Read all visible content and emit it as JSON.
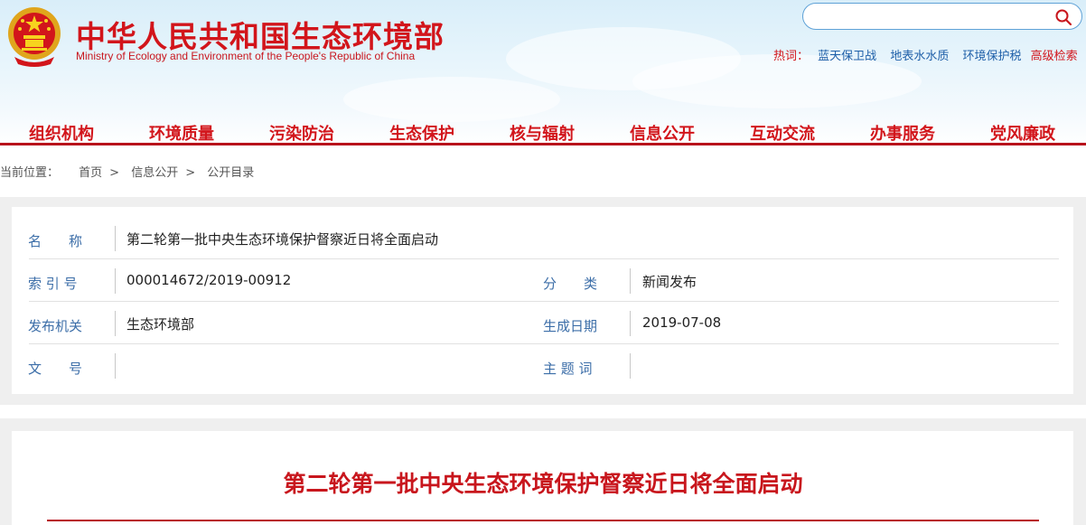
{
  "header": {
    "site_name_cn": "中华人民共和国生态环境部",
    "site_name_en": "Ministry of Ecology and Environment of the People's Republic of China",
    "search_placeholder": "",
    "hot_label": "热词：",
    "hot_words": [
      "蓝天保卫战",
      "地表水水质",
      "环境保护税"
    ],
    "advanced_search": "高级检索"
  },
  "nav": {
    "items": [
      "组织机构",
      "环境质量",
      "污染防治",
      "生态保护",
      "核与辐射",
      "信息公开",
      "互动交流",
      "办事服务",
      "党风廉政"
    ]
  },
  "breadcrumb": {
    "prefix": "当前位置：",
    "items": [
      "首页",
      "信息公开",
      "公开目录"
    ],
    "separator": ">"
  },
  "info": {
    "name_label": "名　　称",
    "name_value": "第二轮第一批中央生态环境保护督察近日将全面启动",
    "index_label": "索 引 号",
    "index_value": "000014672/2019-00912",
    "category_label": "分　　类",
    "category_value": "新闻发布",
    "publisher_label": "发布机关",
    "publisher_value": "生态环境部",
    "date_label": "生成日期",
    "date_value": "2019-07-08",
    "doc_no_label": "文　　号",
    "doc_no_value": "",
    "subject_label": "主 题 词",
    "subject_value": ""
  },
  "article": {
    "title": "第二轮第一批中央生态环境保护督察近日将全面启动"
  },
  "colors": {
    "brand_red": "#d2151b",
    "label_blue": "#3c6ea8",
    "link_blue": "#1e5fa8"
  }
}
